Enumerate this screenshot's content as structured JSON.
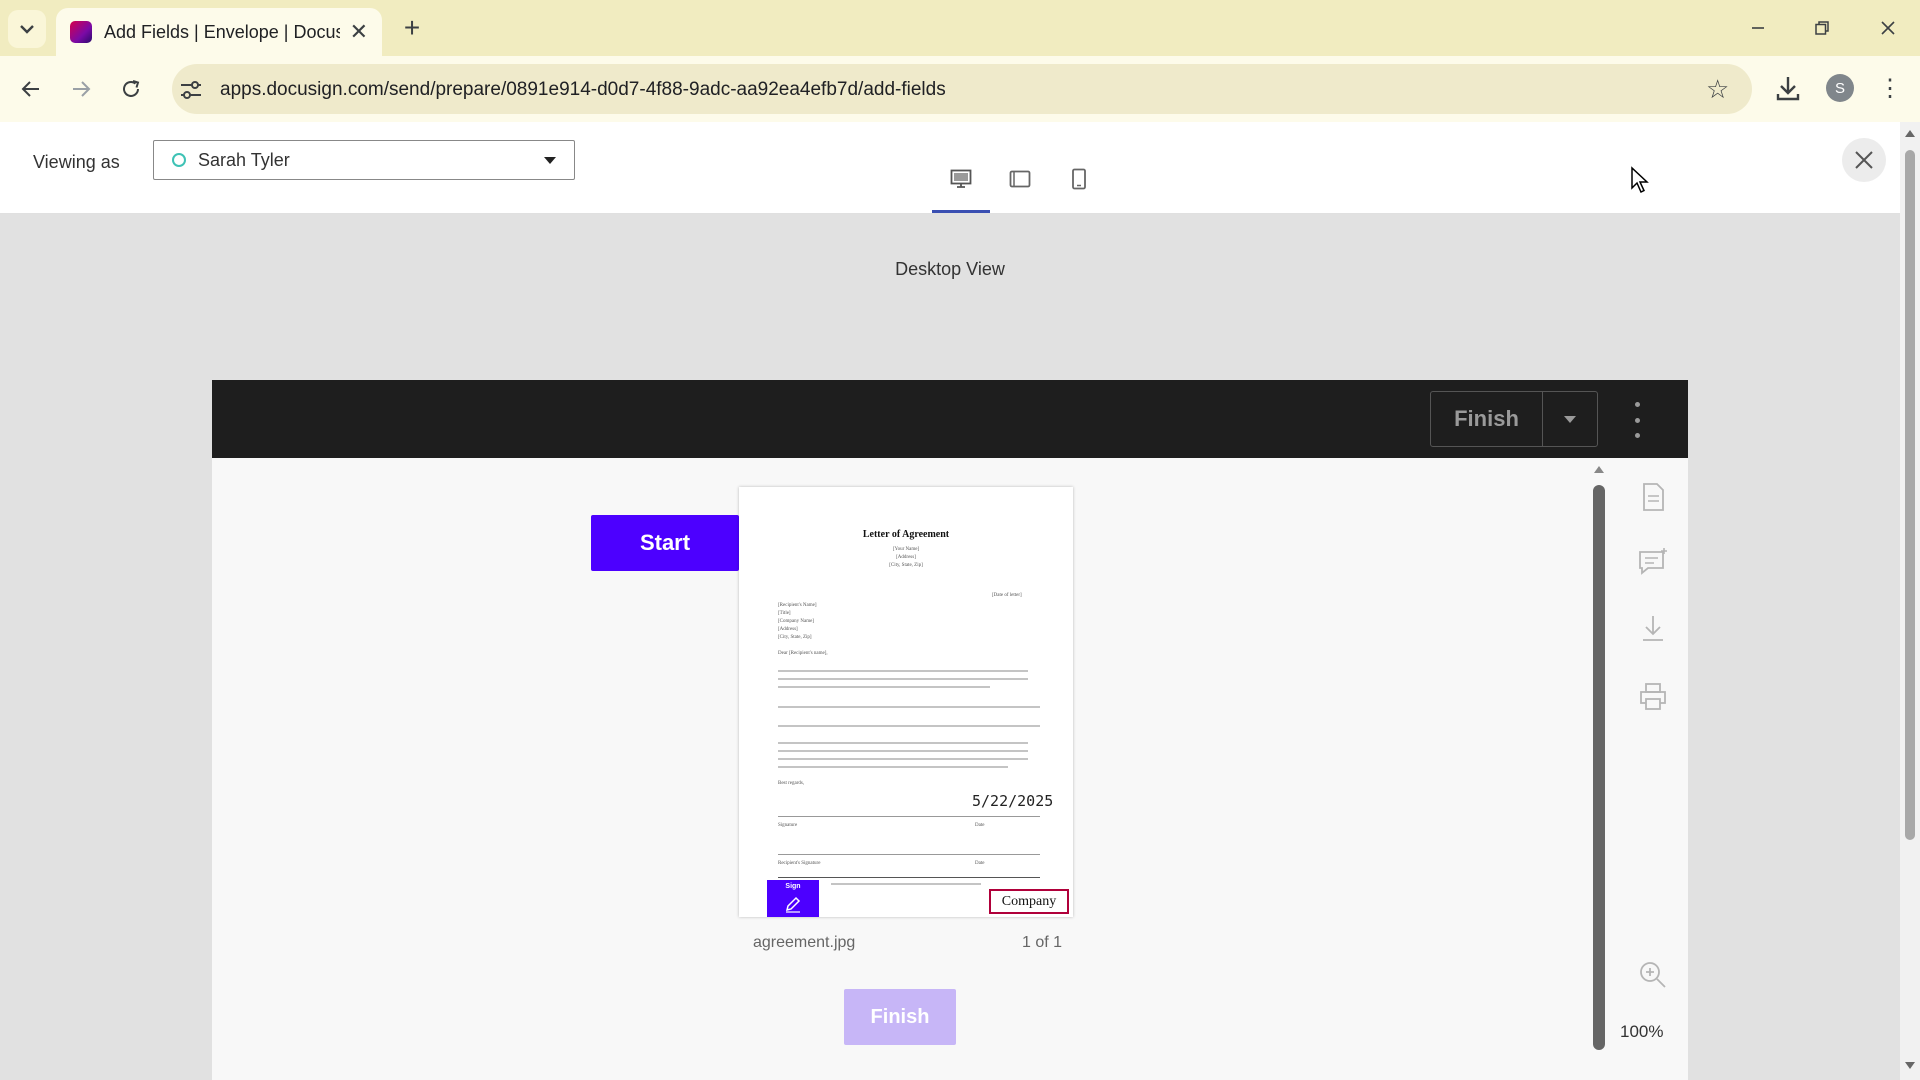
{
  "browser": {
    "tab_title": "Add Fields | Envelope | Docusign",
    "url": "apps.docusign.com/send/prepare/0891e914-d0d7-4f88-9adc-aa92ea4efb7d/add-fields",
    "profile_initial": "S"
  },
  "preview": {
    "viewing_as_label": "Viewing as",
    "recipient": "Sarah Tyler",
    "view_caption": "Desktop View",
    "device_views": [
      "desktop-icon",
      "tablet-icon",
      "mobile-icon"
    ]
  },
  "signing": {
    "finish_label": "Finish",
    "start_label": "Start",
    "finish_bottom_label": "Finish",
    "file_name": "agreement.jpg",
    "page_count": "1 of 1",
    "zoom": "100%",
    "side_tools": [
      "document-icon",
      "comment-icon",
      "download-icon",
      "print-icon",
      "zoom-in-icon"
    ]
  },
  "document": {
    "title": "Letter of Agreement",
    "header_lines": [
      "[Your Name]",
      "[Address]",
      "[City, State, Zip]"
    ],
    "date_placeholder": "[Date of letter]",
    "recipient_lines": [
      "[Recipient's Name]",
      "[Title]",
      "[Company Name]",
      "[Address]",
      "[City, State, Zip]"
    ],
    "salutation": "Dear [Recipient's name],",
    "closing": "Best regards,",
    "signature_label": "Signature",
    "date_label": "Date",
    "recipient_signature_label": "Recipient's Signature",
    "date_value": "5/22/2025",
    "sign_tab_label": "Sign",
    "company_field": "Company"
  },
  "colors": {
    "docusign_primary": "#4c00ff",
    "finish_disabled": "#c7b6f7",
    "company_border": "#b0003a",
    "recipient_dot": "#3ec2b5"
  }
}
